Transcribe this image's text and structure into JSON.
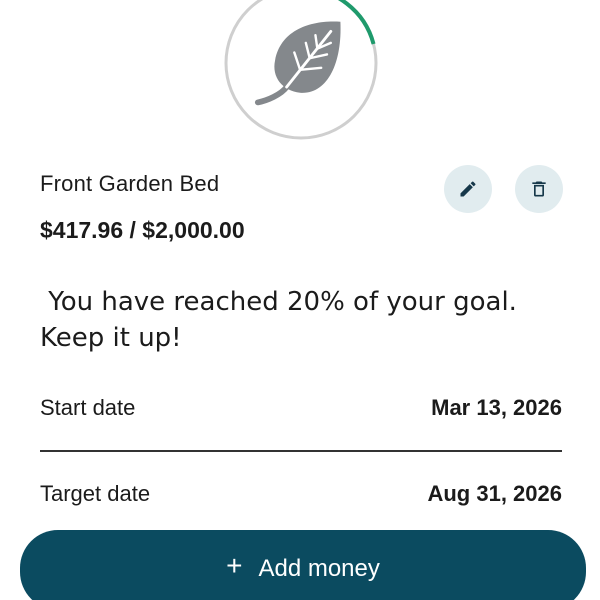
{
  "progress": {
    "fraction": 0.209,
    "ring_color": "#1f9a6c",
    "track_color": "#cfcfcf",
    "icon": "leaf-icon",
    "icon_color": "#84888c"
  },
  "goal": {
    "name": "Front Garden Bed",
    "amount": "$417.96 / $2,000.00"
  },
  "actions": {
    "edit_icon": "pencil-icon",
    "delete_icon": "trash-icon",
    "button_bg": "#e1ecef",
    "icon_color": "#16384a"
  },
  "message": " You have reached 20% of your goal.\nKeep it up!",
  "details": {
    "start_label": "Start date",
    "start_value": "Mar 13, 2026",
    "target_label": "Target date",
    "target_value": "Aug 31, 2026"
  },
  "add_money": {
    "icon": "plus-icon",
    "label": "Add money",
    "bg_color": "#0b4b60"
  }
}
